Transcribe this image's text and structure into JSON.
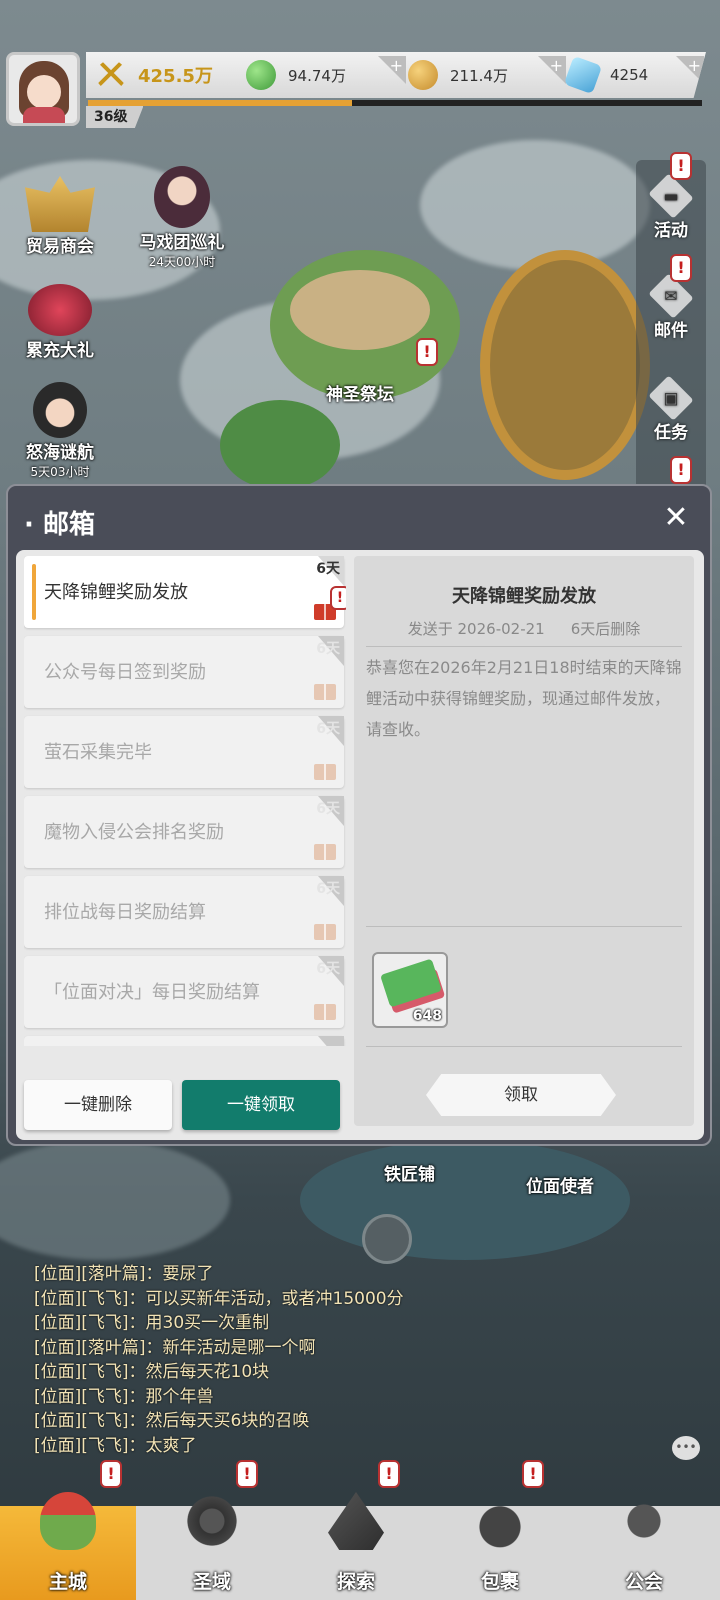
{
  "player": {
    "level": "36级",
    "exp_progress": 0.43
  },
  "resources": {
    "power": "425.5万",
    "green_gem": "94.74万",
    "gold_coin": "211.4万",
    "blue_crystal": "4254"
  },
  "left_events": [
    {
      "label": "贸易商会",
      "timer": ""
    },
    {
      "label": "马戏团巡礼",
      "timer": "24天00小时"
    },
    {
      "label": "累充大礼",
      "timer": ""
    },
    {
      "label": "怒海谜航",
      "timer": "5天03小时"
    }
  ],
  "right_rail": [
    {
      "label": "活动"
    },
    {
      "label": "邮件"
    },
    {
      "label": "任务"
    }
  ],
  "map_labels": {
    "altar": "神圣祭坛",
    "smithy": "铁匠铺",
    "envoy": "位面使者"
  },
  "mailbox": {
    "title": "邮箱",
    "close": "✕",
    "mails": [
      {
        "title": "天降锦鲤奖励发放",
        "days": "6天",
        "selected": true
      },
      {
        "title": "公众号每日签到奖励",
        "days": "6天"
      },
      {
        "title": "萤石采集完毕",
        "days": "6天"
      },
      {
        "title": "魔物入侵公会排名奖励",
        "days": "6天"
      },
      {
        "title": "排位战每日奖励结算",
        "days": "6天"
      },
      {
        "title": "「位面对决」每日奖励结算",
        "days": "6天"
      }
    ],
    "delete_all": "一键删除",
    "claim_all": "一键领取",
    "detail": {
      "title": "天降锦鲤奖励发放",
      "sent_at": "发送于 2026-02-21",
      "expires": "6天后删除",
      "body": "恭喜您在2026年2月21日18时结束的天降锦鲤活动中获得锦鲤奖励，现通过邮件发放，请查收。",
      "reward_count": "648",
      "claim": "领取"
    }
  },
  "chat": [
    "[位面][落叶篇]：要尿了",
    "[位面][飞飞]：可以买新年活动，或者冲15000分",
    "[位面][飞飞]：用30买一次重制",
    "[位面][落叶篇]：新年活动是哪一个啊",
    "[位面][飞飞]：然后每天花10块",
    "[位面][飞飞]：那个年兽",
    "[位面][飞飞]：然后每天买6块的召唤",
    "[位面][飞飞]：太爽了"
  ],
  "bottom_nav": [
    {
      "label": "主城",
      "active": true
    },
    {
      "label": "圣域"
    },
    {
      "label": "探索"
    },
    {
      "label": "包裹"
    },
    {
      "label": "公会"
    }
  ],
  "colors": {
    "accent_orange": "#f0a63a",
    "claim_teal": "#127c6c",
    "gold_text": "#c7951a",
    "alert_red": "#c41e1e"
  }
}
